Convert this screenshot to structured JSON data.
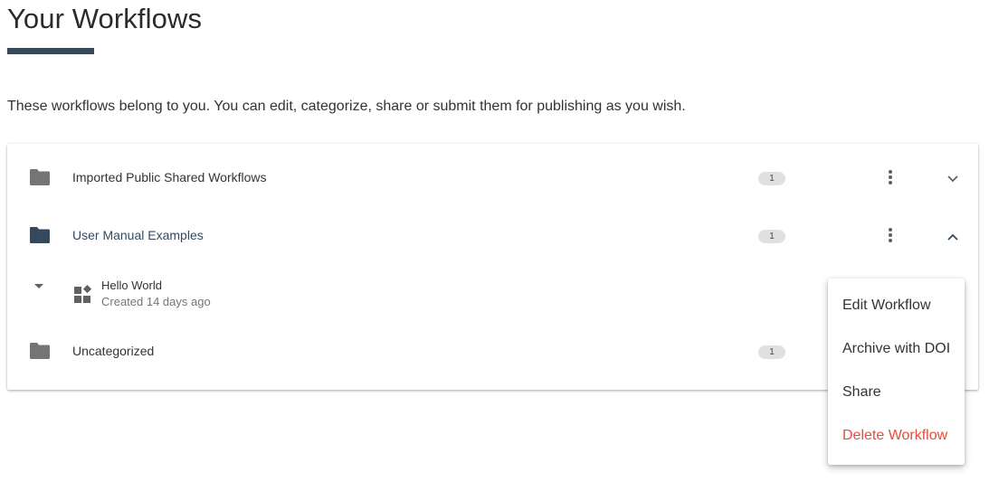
{
  "page": {
    "title": "Your Workflows",
    "intro": "These workflows belong to you. You can edit, categorize, share or submit them for publishing as you wish."
  },
  "colors": {
    "accent": "#34495e",
    "folder_icon_inactive": "#757575",
    "folder_icon_active": "#34495e",
    "danger": "#e74c3c",
    "badge_bg": "#e0e0e0"
  },
  "categories": [
    {
      "label": "Imported Public Shared Workflows",
      "count": "1",
      "icon": "folder-icon",
      "expanded": false
    },
    {
      "label": "User Manual Examples",
      "count": "1",
      "icon": "folder-icon",
      "expanded": true
    },
    {
      "label": "Uncategorized",
      "count": "1",
      "icon": "folder-icon",
      "expanded": false
    }
  ],
  "workflows": [
    {
      "title": "Hello World",
      "subtitle": "Created 14 days ago",
      "icon": "workflow-icon"
    }
  ],
  "context_menu": {
    "items": [
      {
        "label": "Edit Workflow",
        "danger": false
      },
      {
        "label": "Archive with DOI",
        "danger": false
      },
      {
        "label": "Share",
        "danger": false
      },
      {
        "label": "Delete Workflow",
        "danger": true
      }
    ]
  }
}
